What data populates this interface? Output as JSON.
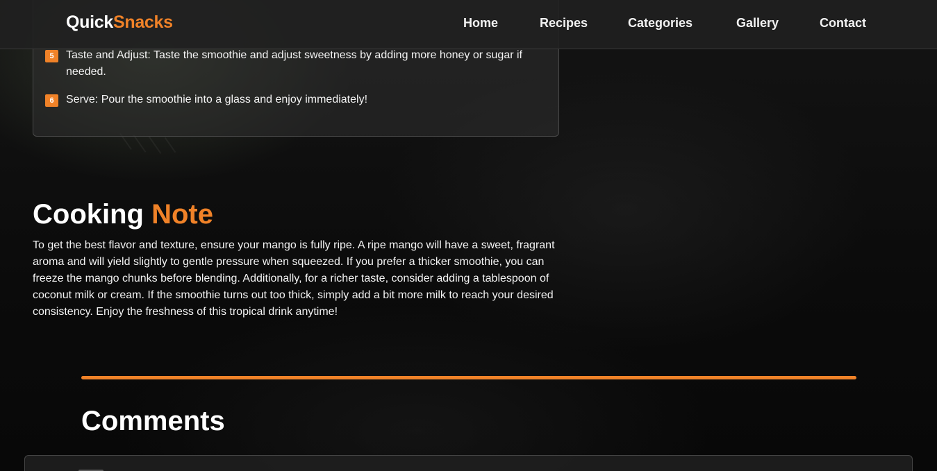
{
  "brand": {
    "part1": "Quick",
    "part2": "Snacks",
    "accent_color": "#f08228"
  },
  "nav": {
    "home": "Home",
    "recipes": "Recipes",
    "categories": "Categories",
    "gallery": "Gallery",
    "contact": "Contact"
  },
  "steps": [
    {
      "number": "5",
      "text": "Taste and Adjust: Taste the smoothie and adjust sweetness by adding more honey or sugar if needed."
    },
    {
      "number": "6",
      "text": "Serve: Pour the smoothie into a glass and enjoy immediately!"
    }
  ],
  "note": {
    "title_part1": "Cooking",
    "title_part2": "Note",
    "text": "To get the best flavor and texture, ensure your mango is fully ripe. A ripe mango will have a sweet, fragrant aroma and will yield slightly to gentle pressure when squeezed. If you prefer a thicker smoothie, you can freeze the mango chunks before blending. Additionally, for a richer taste, consider adding a tablespoon of coconut milk or cream. If the smoothie turns out too thick, simply add a bit more milk to reach your desired consistency. Enjoy the freshness of this tropical drink anytime!"
  },
  "comments": {
    "title": "Comments"
  }
}
